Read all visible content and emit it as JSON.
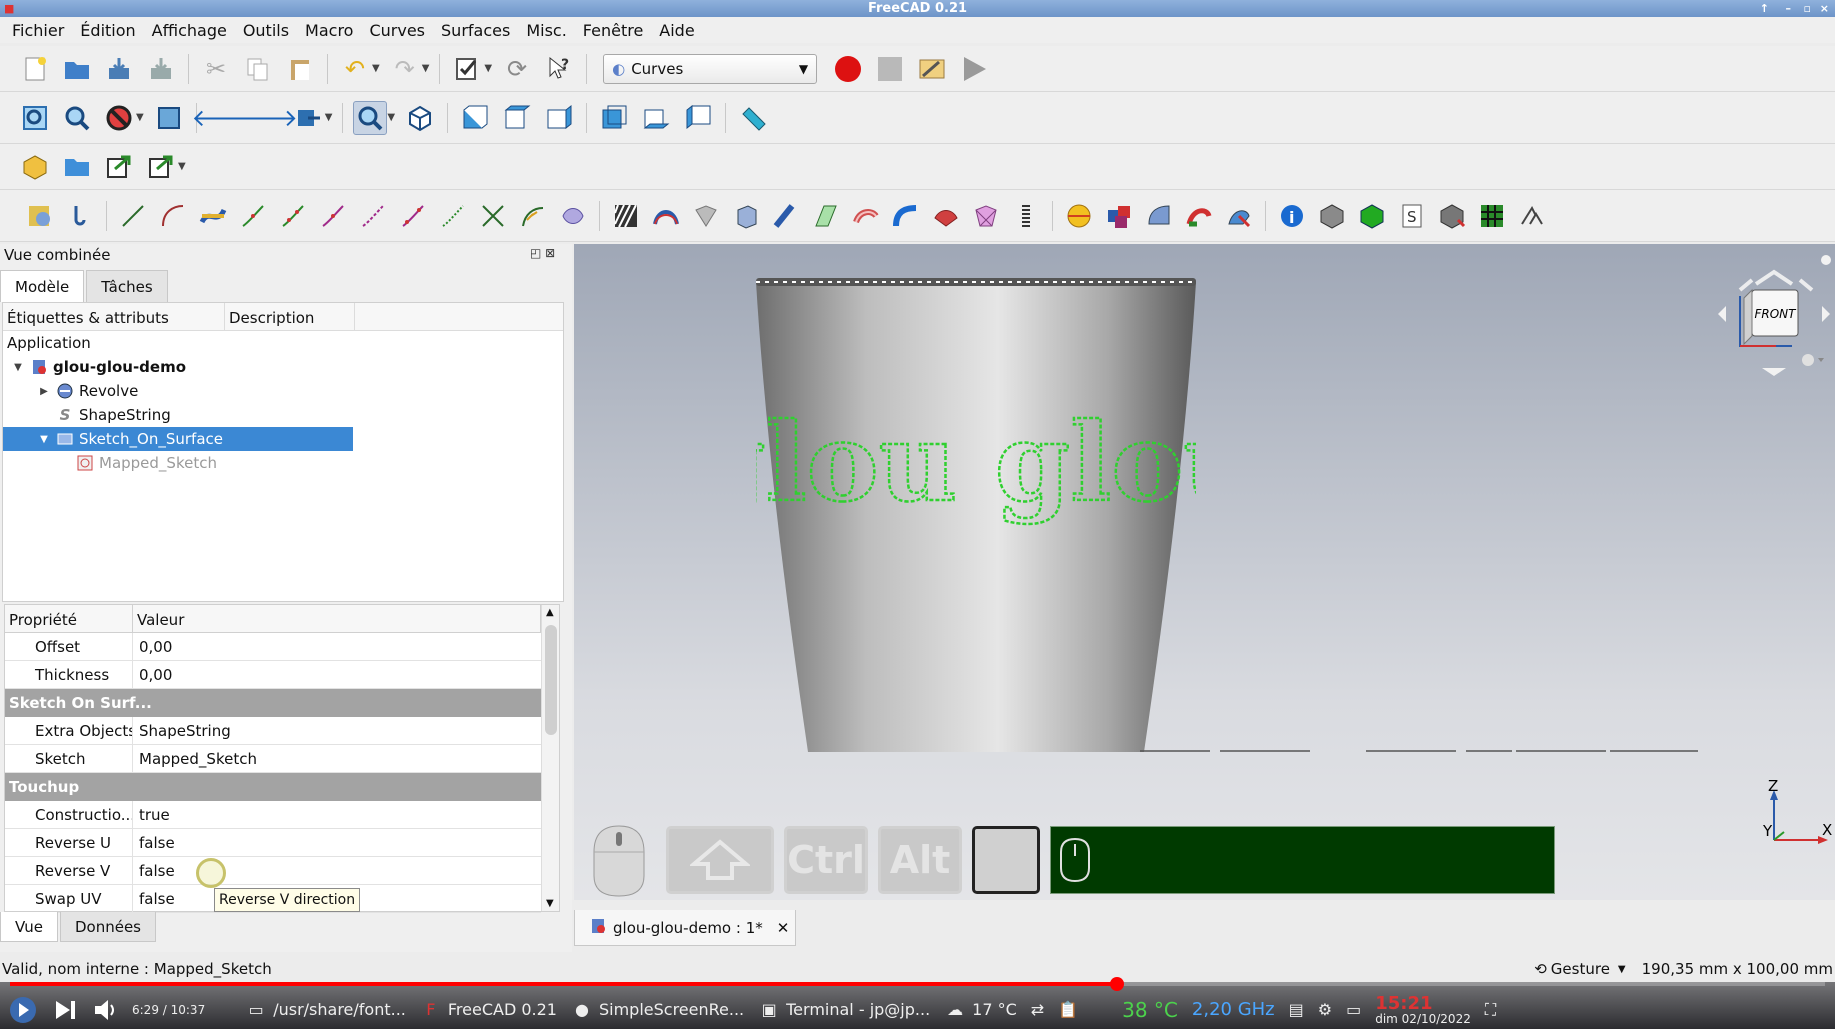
{
  "window": {
    "title": "FreeCAD 0.21",
    "controls": [
      "↑",
      "–",
      "▫",
      "×"
    ]
  },
  "menu": [
    "Fichier",
    "Édition",
    "Affichage",
    "Outils",
    "Macro",
    "Curves",
    "Surfaces",
    "Misc.",
    "Fenêtre",
    "Aide"
  ],
  "toolbar": {
    "workbench": "Curves"
  },
  "combo": {
    "title": "Vue combinée",
    "tabs": [
      "Modèle",
      "Tâches"
    ],
    "tree_columns": [
      "Étiquettes & attributs",
      "Description"
    ],
    "tree": {
      "root": "Application",
      "doc": "glou-glou-demo",
      "items": [
        "Revolve",
        "ShapeString",
        "Sketch_On_Surface",
        "Mapped_Sketch"
      ]
    },
    "props_columns": [
      "Propriété",
      "Valeur"
    ],
    "props": {
      "offset": {
        "name": "Offset",
        "value": "0,00"
      },
      "thickness": {
        "name": "Thickness",
        "value": "0,00"
      },
      "group1": "Sketch On Surf...",
      "extra": {
        "name": "Extra Objects",
        "value": "ShapeString"
      },
      "sketch": {
        "name": "Sketch",
        "value": "Mapped_Sketch"
      },
      "group2": "Touchup",
      "construction": {
        "name": "Constructio...",
        "value": "true"
      },
      "revu": {
        "name": "Reverse U",
        "value": "false"
      },
      "revv": {
        "name": "Reverse V",
        "value": "false"
      },
      "swap": {
        "name": "Swap UV",
        "value": "false"
      }
    },
    "tooltip": "Reverse V direction",
    "bottom_tabs": [
      "Vue",
      "Données"
    ]
  },
  "viewport": {
    "navcube_face": "FRONT",
    "cup_text": "glou glou",
    "axis": {
      "z": "Z",
      "y": "Y",
      "x": "X"
    },
    "keys": [
      "Ctrl",
      "Alt"
    ],
    "doc_tab": "glou-glou-demo : 1*"
  },
  "status": {
    "left": "Valid, nom interne : Mapped_Sketch",
    "nav_style": "Gesture",
    "dimensions": "190,35 mm x 100,00 mm"
  },
  "video": {
    "time": "6:29 / 10:37",
    "progress": 0.61,
    "tasks": [
      "/usr/share/font...",
      "FreeCAD 0.21",
      "SimpleScreenRe...",
      "Terminal - jp@jp..."
    ],
    "weather": "17 °C",
    "cpu_temp": "38 °C",
    "freq": "2,20 GHz",
    "clock": "15:21",
    "date": "dim 02/10/2022"
  },
  "colors": {
    "accent": "#3b88d4",
    "record": "#dd1111",
    "sketch": "#2fd02f",
    "progress": "#ff0000",
    "keybar": "#003a00"
  }
}
